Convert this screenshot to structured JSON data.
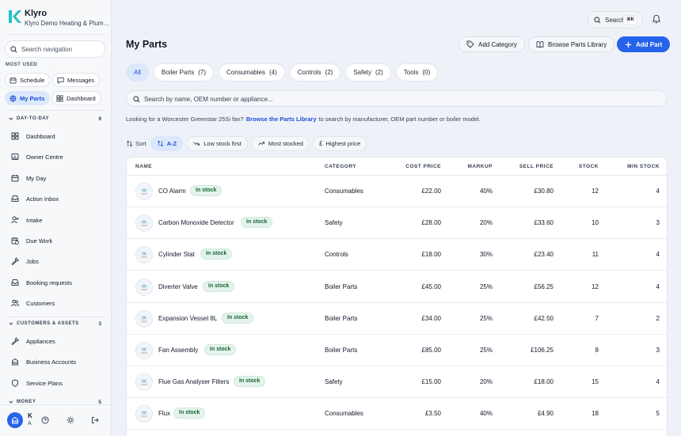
{
  "brand": {
    "name": "Klyro",
    "subtitle": "Klyro Demo Heating & Plumbing"
  },
  "sidebar": {
    "search_placeholder": "Search navigation",
    "most_used_label": "MOST USED",
    "most_used": [
      {
        "label": "Schedule",
        "icon": "calendar-icon",
        "active": false
      },
      {
        "label": "Messages",
        "icon": "message-icon",
        "active": false
      },
      {
        "label": "My Parts",
        "icon": "parts-icon",
        "active": true
      },
      {
        "label": "Dashboard",
        "icon": "dashboard-icon",
        "active": false
      }
    ],
    "groups": [
      {
        "label": "DAY-TO-DAY",
        "count": "9",
        "items": [
          {
            "label": "Dashboard",
            "icon": "dashboard-icon"
          },
          {
            "label": "Owner Centre",
            "icon": "owner-centre-icon"
          },
          {
            "label": "My Day",
            "icon": "calendar-icon"
          },
          {
            "label": "Action Inbox",
            "icon": "inbox-icon"
          },
          {
            "label": "Intake",
            "icon": "user-plus-icon"
          },
          {
            "label": "Due Work",
            "icon": "calendar-clock-icon"
          },
          {
            "label": "Jobs",
            "icon": "wrench-icon"
          },
          {
            "label": "Booking requests",
            "icon": "inbox-icon"
          },
          {
            "label": "Customers",
            "icon": "users-icon"
          }
        ]
      },
      {
        "label": "CUSTOMERS & ASSETS",
        "count": "3",
        "items": [
          {
            "label": "Appliances",
            "icon": "wrench-icon"
          },
          {
            "label": "Business Accounts",
            "icon": "building-icon"
          },
          {
            "label": "Service Plans",
            "icon": "shield-icon"
          }
        ]
      },
      {
        "label": "MONEY",
        "count": "5",
        "items": []
      }
    ],
    "footer": {
      "initial": "K",
      "sub": "A"
    }
  },
  "topbar": {
    "search_label": "Search",
    "shortcut": "⌘K"
  },
  "header": {
    "title": "My Parts",
    "add_category": "Add Category",
    "browse_library": "Browse Parts Library",
    "add_part": "Add Part"
  },
  "tabs": [
    {
      "label": "All",
      "count": "",
      "active": true
    },
    {
      "label": "Boiler Parts",
      "count": "(7)",
      "active": false
    },
    {
      "label": "Consumables",
      "count": "(4)",
      "active": false
    },
    {
      "label": "Controls",
      "count": "(2)",
      "active": false
    },
    {
      "label": "Safety",
      "count": "(2)",
      "active": false
    },
    {
      "label": "Tools",
      "count": "(0)",
      "active": false
    }
  ],
  "search": {
    "placeholder": "Search by name, OEM number or appliance..."
  },
  "hint": {
    "before": "Looking for a Worcester Greenstar 25Si fan?",
    "link": "Browse the Parts Library",
    "after": "to search by manufacturer, OEM part number or boiler model."
  },
  "sort": {
    "label": "Sort",
    "options": [
      {
        "label": "A-Z",
        "icon": "sort-icon",
        "active": true
      },
      {
        "label": "Low stock first",
        "icon": "trending-down-icon",
        "active": false
      },
      {
        "label": "Most stocked",
        "icon": "trending-up-icon",
        "active": false
      },
      {
        "label": "Highest price",
        "icon": "pound-icon",
        "active": false
      }
    ]
  },
  "table": {
    "columns": [
      "NAME",
      "CATEGORY",
      "COST PRICE",
      "MARKUP",
      "SELL PRICE",
      "STOCK",
      "MIN STOCK"
    ],
    "rows": [
      {
        "name": "CO Alarm",
        "badge": "In stock",
        "category": "Consumables",
        "cost": "£22.00",
        "markup": "40%",
        "sell": "£30.80",
        "stock": "12",
        "min": "4"
      },
      {
        "name": "Carbon Monoxide Detector",
        "badge": "In stock",
        "category": "Safety",
        "cost": "£28.00",
        "markup": "20%",
        "sell": "£33.60",
        "stock": "10",
        "min": "3"
      },
      {
        "name": "Cylinder Stat",
        "badge": "In stock",
        "category": "Controls",
        "cost": "£18.00",
        "markup": "30%",
        "sell": "£23.40",
        "stock": "11",
        "min": "4"
      },
      {
        "name": "Diverter Valve",
        "badge": "In stock",
        "category": "Boiler Parts",
        "cost": "£45.00",
        "markup": "25%",
        "sell": "£56.25",
        "stock": "12",
        "min": "4"
      },
      {
        "name": "Expansion Vessel 8L",
        "badge": "In stock",
        "category": "Boiler Parts",
        "cost": "£34.00",
        "markup": "25%",
        "sell": "£42.50",
        "stock": "7",
        "min": "2"
      },
      {
        "name": "Fan Assembly",
        "badge": "In stock",
        "category": "Boiler Parts",
        "cost": "£85.00",
        "markup": "25%",
        "sell": "£106.25",
        "stock": "8",
        "min": "3"
      },
      {
        "name": "Flue Gas Analyser Filters",
        "badge": "In stock",
        "category": "Safety",
        "cost": "£15.00",
        "markup": "20%",
        "sell": "£18.00",
        "stock": "15",
        "min": "4"
      },
      {
        "name": "Flux",
        "badge": "In stock",
        "category": "Consumables",
        "cost": "£3.50",
        "markup": "40%",
        "sell": "£4.90",
        "stock": "18",
        "min": "5"
      }
    ]
  },
  "colors": {
    "accent": "#2563eb",
    "accent_soft": "#dbe8fb",
    "in_stock_bg": "#e4f4ec",
    "in_stock_text": "#166534",
    "logo": "#22c1c3"
  }
}
